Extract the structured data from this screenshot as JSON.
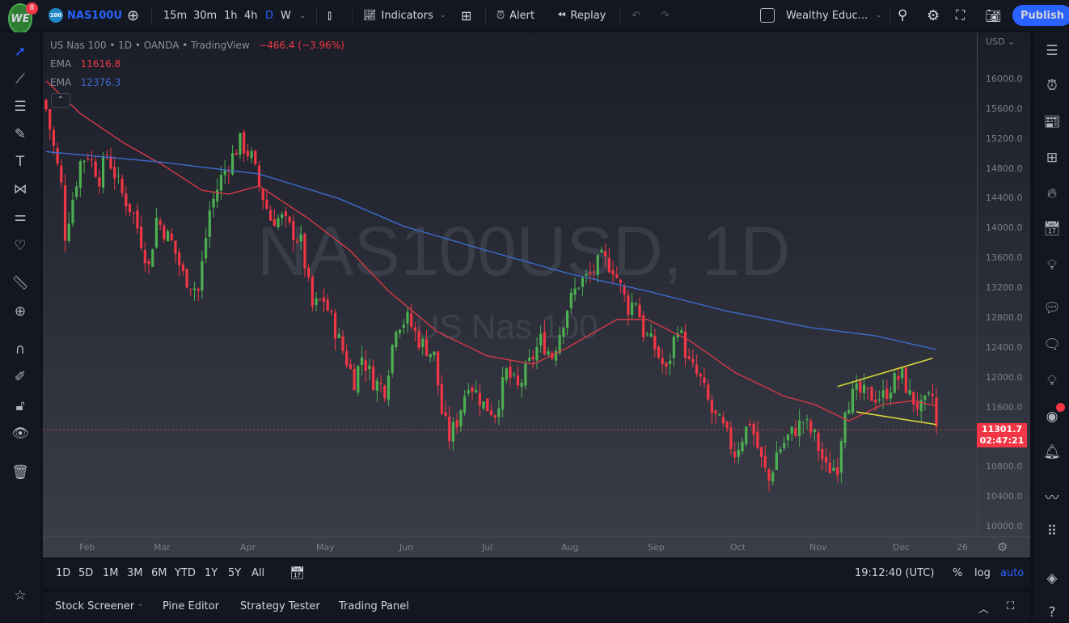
{
  "topbar": {
    "logo_text": "WE",
    "notifications": "8",
    "symbol_icon": "100",
    "symbol": "NAS100U",
    "timeframes": [
      "15m",
      "30m",
      "1h",
      "4h",
      "D",
      "W"
    ],
    "active_timeframe": "D",
    "indicators": "Indicators",
    "alert": "Alert",
    "replay": "Replay",
    "layout_name": "Wealthy Educ...",
    "publish": "Publish"
  },
  "legend": {
    "title": "US Nas 100 • 1D • OANDA • TradingView",
    "change": "−466.4 (−3.96%)",
    "ema1_label": "EMA",
    "ema1_value": "11616.8",
    "ema2_label": "EMA",
    "ema2_value": "12376.3"
  },
  "watermark": {
    "line1": "NAS100USD, 1D",
    "line2": "US Nas 100"
  },
  "price_axis": {
    "currency": "USD",
    "ticks": [
      "16000.0",
      "15600.0",
      "15200.0",
      "14800.0",
      "14400.0",
      "14000.0",
      "13600.0",
      "13200.0",
      "12800.0",
      "12400.0",
      "12000.0",
      "11600.0",
      "10800.0",
      "10400.0",
      "10000.0"
    ],
    "last_price": "11301.7",
    "countdown": "02:47:21"
  },
  "time_axis": {
    "labels": [
      "Feb",
      "Mar",
      "Apr",
      "May",
      "Jun",
      "Jul",
      "Aug",
      "Sep",
      "Oct",
      "Nov",
      "Dec",
      "26"
    ]
  },
  "bottom_bar": {
    "ranges": [
      "1D",
      "5D",
      "1M",
      "3M",
      "6M",
      "YTD",
      "1Y",
      "5Y",
      "All"
    ],
    "clock": "19:12:40 (UTC)",
    "percent": "%",
    "log": "log",
    "auto": "auto"
  },
  "bottom_panel": {
    "tabs": [
      "Stock Screener",
      "Pine Editor",
      "Strategy Tester",
      "Trading Panel"
    ]
  },
  "colors": {
    "up": "#4caf50",
    "down": "#f23645",
    "ema_fast": "#e03a48",
    "ema_slow": "#3d6fd6",
    "wedge": "#d4d43a"
  },
  "chart_data": {
    "type": "candlestick",
    "y_range": [
      10000,
      16000
    ],
    "candles_count": 235,
    "close_waypoints": [
      [
        0,
        15600
      ],
      [
        4,
        14570
      ],
      [
        5,
        13920
      ],
      [
        9,
        14890
      ],
      [
        11,
        15000
      ],
      [
        14,
        14680
      ],
      [
        16,
        15000
      ],
      [
        20,
        14460
      ],
      [
        23,
        14190
      ],
      [
        27,
        13480
      ],
      [
        29,
        14130
      ],
      [
        33,
        13810
      ],
      [
        36,
        13370
      ],
      [
        40,
        13160
      ],
      [
        43,
        14240
      ],
      [
        46,
        14680
      ],
      [
        51,
        15160
      ],
      [
        54,
        14950
      ],
      [
        56,
        14570
      ],
      [
        59,
        14130
      ],
      [
        62,
        14130
      ],
      [
        67,
        13810
      ],
      [
        70,
        12940
      ],
      [
        73,
        13050
      ],
      [
        77,
        12500
      ],
      [
        81,
        11960
      ],
      [
        83,
        12290
      ],
      [
        86,
        11960
      ],
      [
        89,
        11850
      ],
      [
        92,
        12720
      ],
      [
        95,
        12780
      ],
      [
        98,
        12500
      ],
      [
        102,
        12290
      ],
      [
        104,
        11530
      ],
      [
        106,
        11200
      ],
      [
        108,
        11420
      ],
      [
        111,
        11960
      ],
      [
        115,
        11640
      ],
      [
        118,
        11530
      ],
      [
        121,
        12070
      ],
      [
        124,
        11850
      ],
      [
        127,
        12180
      ],
      [
        130,
        12500
      ],
      [
        133,
        12290
      ],
      [
        137,
        12940
      ],
      [
        140,
        13270
      ],
      [
        143,
        13370
      ],
      [
        146,
        13590
      ],
      [
        149,
        13480
      ],
      [
        153,
        12940
      ],
      [
        155,
        13050
      ],
      [
        157,
        12610
      ],
      [
        160,
        12400
      ],
      [
        163,
        12070
      ],
      [
        166,
        12720
      ],
      [
        169,
        12180
      ],
      [
        172,
        11960
      ],
      [
        175,
        11530
      ],
      [
        178,
        11310
      ],
      [
        181,
        10990
      ],
      [
        185,
        11420
      ],
      [
        188,
        10880
      ],
      [
        190,
        10610
      ],
      [
        192,
        10990
      ],
      [
        195,
        11200
      ],
      [
        199,
        11420
      ],
      [
        202,
        11200
      ],
      [
        205,
        10770
      ],
      [
        208,
        10820
      ],
      [
        210,
        11640
      ],
      [
        213,
        11800
      ],
      [
        217,
        11750
      ],
      [
        220,
        11750
      ],
      [
        223,
        11960
      ],
      [
        225,
        12020
      ],
      [
        227,
        11750
      ],
      [
        230,
        11580
      ],
      [
        233,
        11750
      ],
      [
        234,
        11310
      ]
    ],
    "ema_fast_waypoints": [
      [
        0,
        15980
      ],
      [
        9,
        15540
      ],
      [
        20,
        15160
      ],
      [
        31,
        14840
      ],
      [
        41,
        14510
      ],
      [
        48,
        14460
      ],
      [
        56,
        14570
      ],
      [
        69,
        14130
      ],
      [
        80,
        13700
      ],
      [
        90,
        13160
      ],
      [
        103,
        12610
      ],
      [
        116,
        12290
      ],
      [
        128,
        12180
      ],
      [
        137,
        12400
      ],
      [
        150,
        12780
      ],
      [
        158,
        12780
      ],
      [
        169,
        12500
      ],
      [
        181,
        12070
      ],
      [
        194,
        11750
      ],
      [
        202,
        11640
      ],
      [
        211,
        11420
      ],
      [
        220,
        11640
      ],
      [
        228,
        11690
      ],
      [
        234,
        11617
      ]
    ],
    "ema_slow_waypoints": [
      [
        0,
        15030
      ],
      [
        30,
        14890
      ],
      [
        56,
        14730
      ],
      [
        77,
        14400
      ],
      [
        94,
        14030
      ],
      [
        116,
        13700
      ],
      [
        137,
        13400
      ],
      [
        158,
        13160
      ],
      [
        179,
        12890
      ],
      [
        201,
        12670
      ],
      [
        218,
        12560
      ],
      [
        234,
        12376
      ]
    ],
    "wedge_upper": [
      [
        208,
        11880
      ],
      [
        233,
        12260
      ]
    ],
    "wedge_lower": [
      [
        213,
        11540
      ],
      [
        234,
        11370
      ]
    ],
    "last_price": 11301.7
  }
}
